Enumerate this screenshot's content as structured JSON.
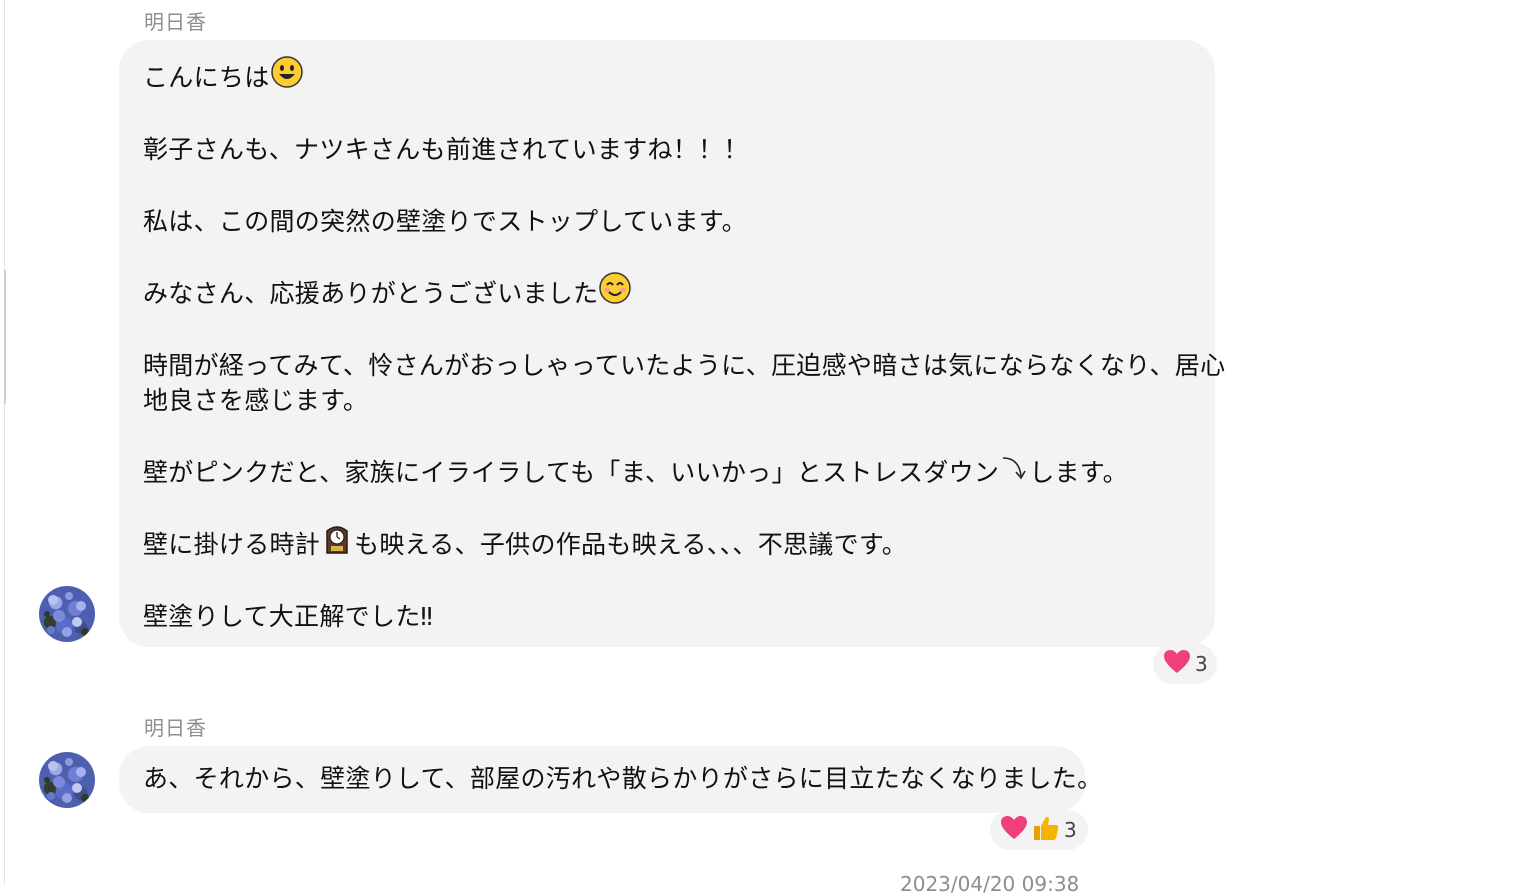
{
  "messages": [
    {
      "sender": "明日香",
      "lines": [
        "こんにちは",
        "",
        "彰子さんも、ナツキさんも前進されていますね！！！",
        "",
        "私は、この間の突然の壁塗りでストップしています。",
        "",
        "みなさん、応援ありがとうございました",
        "",
        "時間が経ってみて、怜さんがおっしゃっていたように、圧迫感や暗さは気にならなくなり、居心",
        "地良さを感じます。",
        "",
        "壁がピンクだと、家族にイライラしても「ま、いいかっ」とストレスダウン",
        "します。",
        "",
        "壁に掛ける時計",
        "も映える、子供の作品も映える、、、不思議です。",
        "",
        "壁塗りして大正解でした‼"
      ],
      "reactions": {
        "icons": [
          "heart-icon"
        ],
        "count": "3"
      }
    },
    {
      "sender": "明日香",
      "text": "あ、それから、壁塗りして、部屋の汚れや散らかりがさらに目立たなくなりました。",
      "reactions": {
        "icons": [
          "heart-icon",
          "thumbs-up-icon"
        ],
        "count": "3"
      }
    }
  ],
  "timestamp": "2023/04/20 09:38",
  "colors": {
    "bubble": "#f3f3f3",
    "meta": "#8e8e8e",
    "heart": "#f0407a",
    "thumb": "#f5b400"
  }
}
